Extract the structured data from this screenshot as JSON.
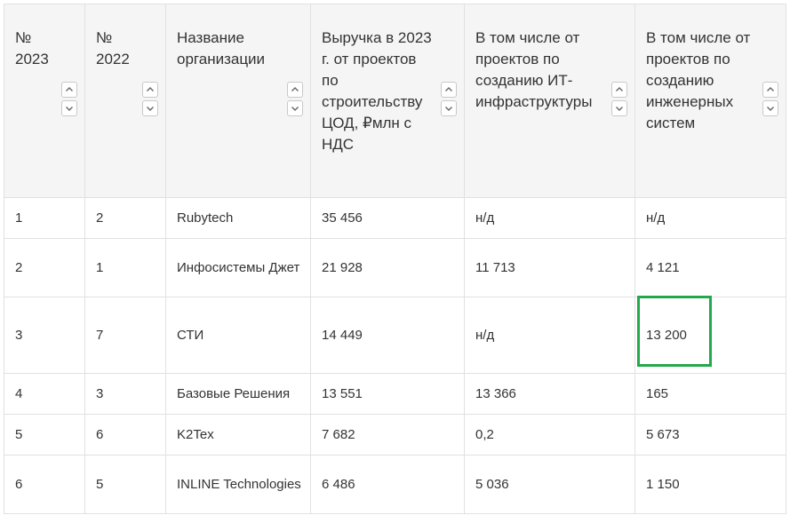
{
  "table": {
    "headers": [
      "№ 2023",
      "№ 2022",
      "Название организации",
      "Выручка в 2023 г. от проектов по строительству ЦОД, ₽млн с НДС",
      "В том числе от проектов по созданию ИТ-инфраструктуры",
      "В том числе от проектов по созданию инженерных систем"
    ],
    "rows": [
      [
        "1",
        "2",
        "Rubytech",
        "35 456",
        "н/д",
        "н/д"
      ],
      [
        "2",
        "1",
        "Инфосистемы Джет",
        "21 928",
        "11 713",
        "4 121"
      ],
      [
        "3",
        "7",
        "СТИ",
        "14 449",
        "н/д",
        "13 200"
      ],
      [
        "4",
        "3",
        "Базовые Решения",
        "13 551",
        "13 366",
        "165"
      ],
      [
        "5",
        "6",
        "K2Tex",
        "7 682",
        "0,2",
        "5 673"
      ],
      [
        "6",
        "5",
        "INLINE Technologies",
        "6 486",
        "5 036",
        "1 150"
      ]
    ],
    "highlight_color": "#23a94b",
    "highlighted_cell": "13 200"
  }
}
